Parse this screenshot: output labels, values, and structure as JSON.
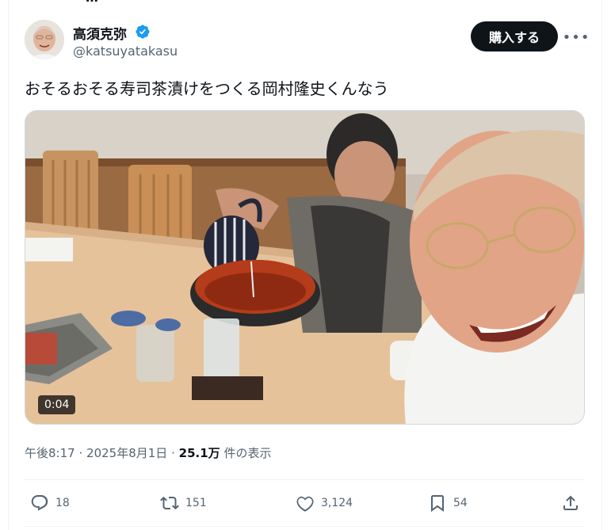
{
  "header_fragment": "⋯",
  "author": {
    "display_name": "高須克弥",
    "handle": "@katsuyatakasu",
    "verified": true,
    "avatar_icon": "profile-photo"
  },
  "buy_button_label": "購入する",
  "more_icon": "more-horizontal-icon",
  "post_text": "おそるおそる寿司茶漬けをつくる岡村隆史くんなう",
  "media": {
    "type": "video",
    "duration": "0:04"
  },
  "meta": {
    "time": "午後8:17",
    "separator1": "·",
    "date": "2025年8月1日",
    "separator2": "·",
    "views_count": "25.1万",
    "views_label": "件の表示"
  },
  "actions": {
    "reply": {
      "icon": "reply-icon",
      "count": "18"
    },
    "repost": {
      "icon": "repost-icon",
      "count": "151"
    },
    "like": {
      "icon": "heart-icon",
      "count": "3,124"
    },
    "bookmark": {
      "icon": "bookmark-icon",
      "count": "54"
    },
    "share": {
      "icon": "share-icon"
    }
  },
  "colors": {
    "text_primary": "#0f1419",
    "text_secondary": "#536471",
    "verified_blue": "#1d9bf0",
    "button_bg": "#0f1419"
  }
}
